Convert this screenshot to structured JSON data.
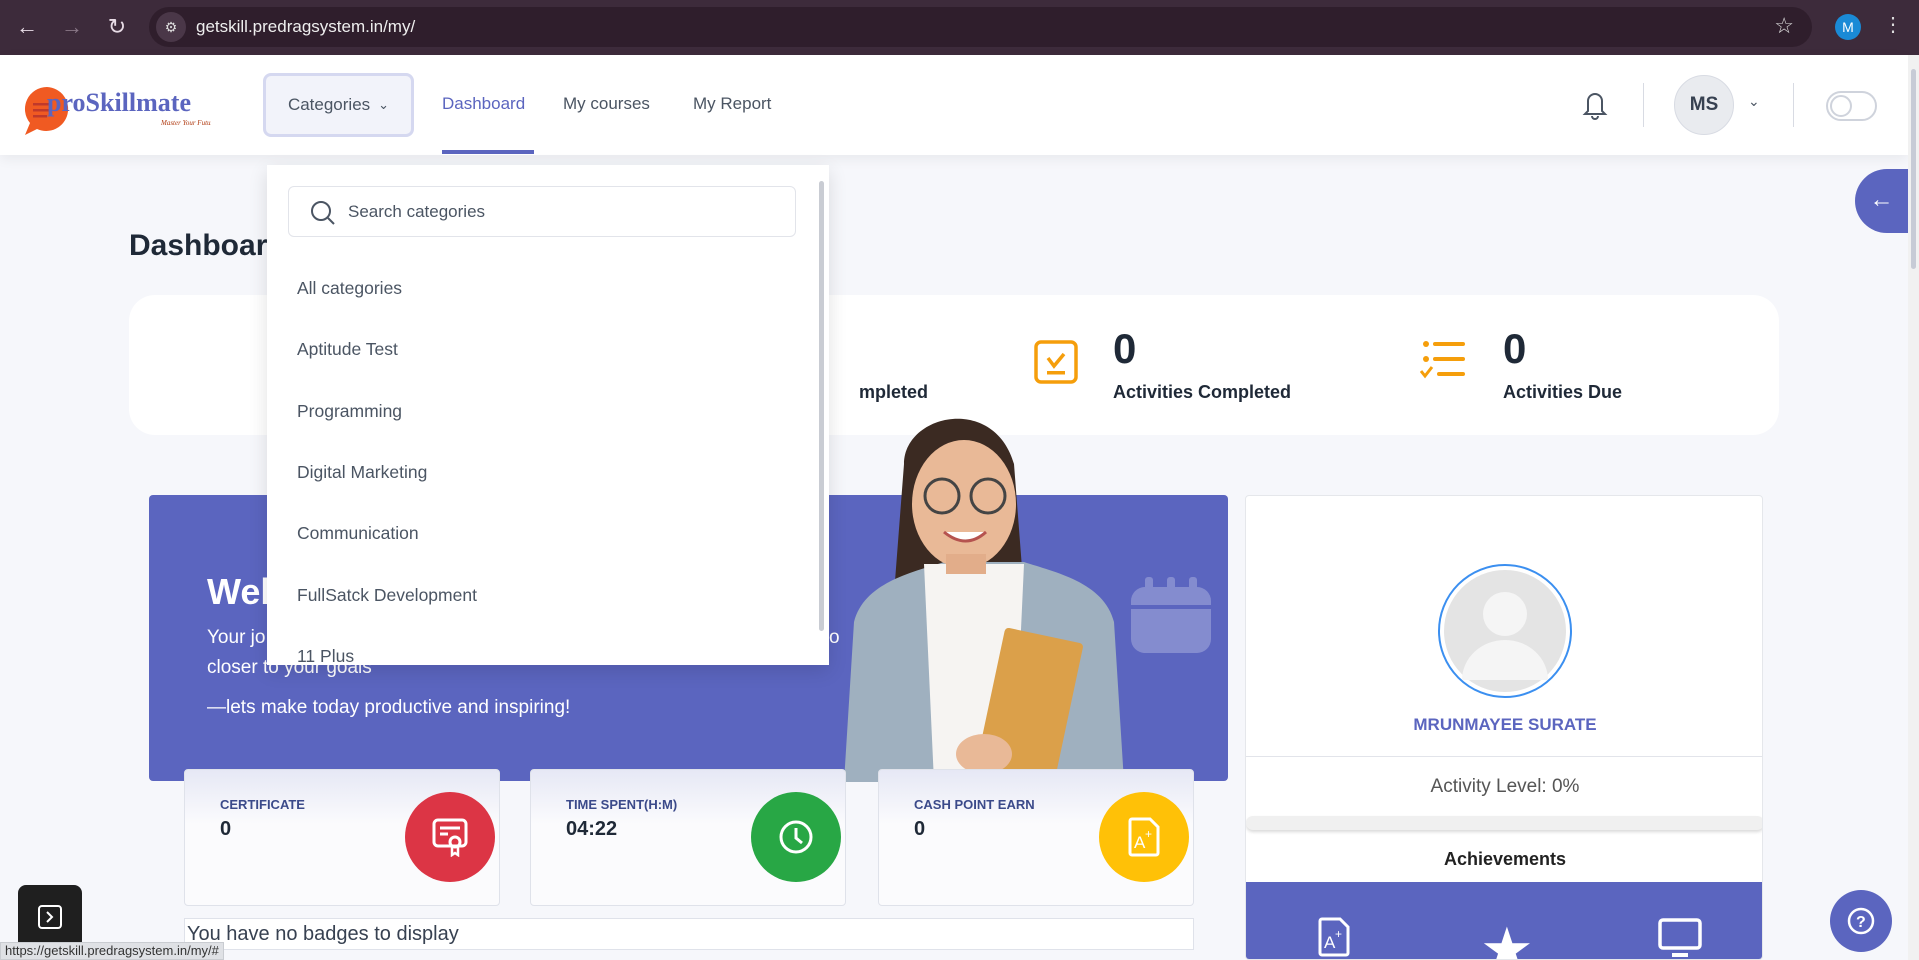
{
  "browser": {
    "url": "getskill.predragsystem.in/my/",
    "profile_initial": "M",
    "status_url": "https://getskill.predragsystem.in/my/#"
  },
  "header": {
    "logo_text": "proSkillmate",
    "logo_tagline": "Master Your Future!",
    "categories_label": "Categories",
    "nav": [
      "Dashboard",
      "My courses",
      "My Report"
    ],
    "active_nav": "Dashboard",
    "avatar_initials": "MS"
  },
  "categories_dropdown": {
    "search_placeholder": "Search categories",
    "items": [
      "All categories",
      "Aptitude Test",
      "Programming",
      "Digital Marketing",
      "Communication",
      "FullSatck Development",
      "11 Plus"
    ]
  },
  "page": {
    "title": "Dashboard"
  },
  "stats": [
    {
      "label": "mpleted"
    },
    {
      "value": "0",
      "label": "Activities Completed",
      "icon": "clipboard-check-icon"
    },
    {
      "value": "0",
      "label": "Activities Due",
      "icon": "checklist-icon"
    }
  ],
  "welcome": {
    "heading": "Wel",
    "line1": "Your jo",
    "line1_tail": "o",
    "line2": "closer to your goals",
    "line3": "—lets make today productive and inspiring!"
  },
  "cards": [
    {
      "label": "CERTIFICATE",
      "value": "0",
      "color": "#dc3545",
      "icon": "certificate-icon"
    },
    {
      "label": "TIME SPENT(H:M)",
      "value": "04:22",
      "color": "#28a745",
      "icon": "clock-icon"
    },
    {
      "label": "CASH POINT EARN",
      "value": "0",
      "color": "#ffc107",
      "icon": "grade-document-icon"
    }
  ],
  "badges_text": "You have no badges to display",
  "profile": {
    "name": "MRUNMAYEE SURATE",
    "activity_level": "Activity Level: 0%",
    "activity_percent": 0,
    "achievements_label": "Achievements"
  },
  "colors": {
    "brand": "#5b65bf",
    "accent": "#f59e0b"
  }
}
